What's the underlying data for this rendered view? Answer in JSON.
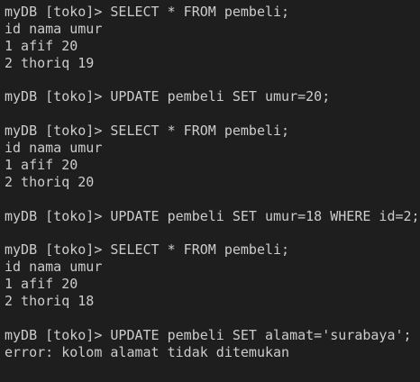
{
  "terminal": {
    "lines": [
      "myDB [toko]> SELECT * FROM pembeli;",
      "id nama umur",
      "1 afif 20",
      "2 thoriq 19",
      "",
      "myDB [toko]> UPDATE pembeli SET umur=20;",
      "",
      "myDB [toko]> SELECT * FROM pembeli;",
      "id nama umur",
      "1 afif 20",
      "2 thoriq 20",
      "",
      "myDB [toko]> UPDATE pembeli SET umur=18 WHERE id=2;",
      "",
      "myDB [toko]> SELECT * FROM pembeli;",
      "id nama umur",
      "1 afif 20",
      "2 thoriq 18",
      "",
      "myDB [toko]> UPDATE pembeli SET alamat='surabaya';",
      "error: kolom alamat tidak ditemukan"
    ]
  }
}
